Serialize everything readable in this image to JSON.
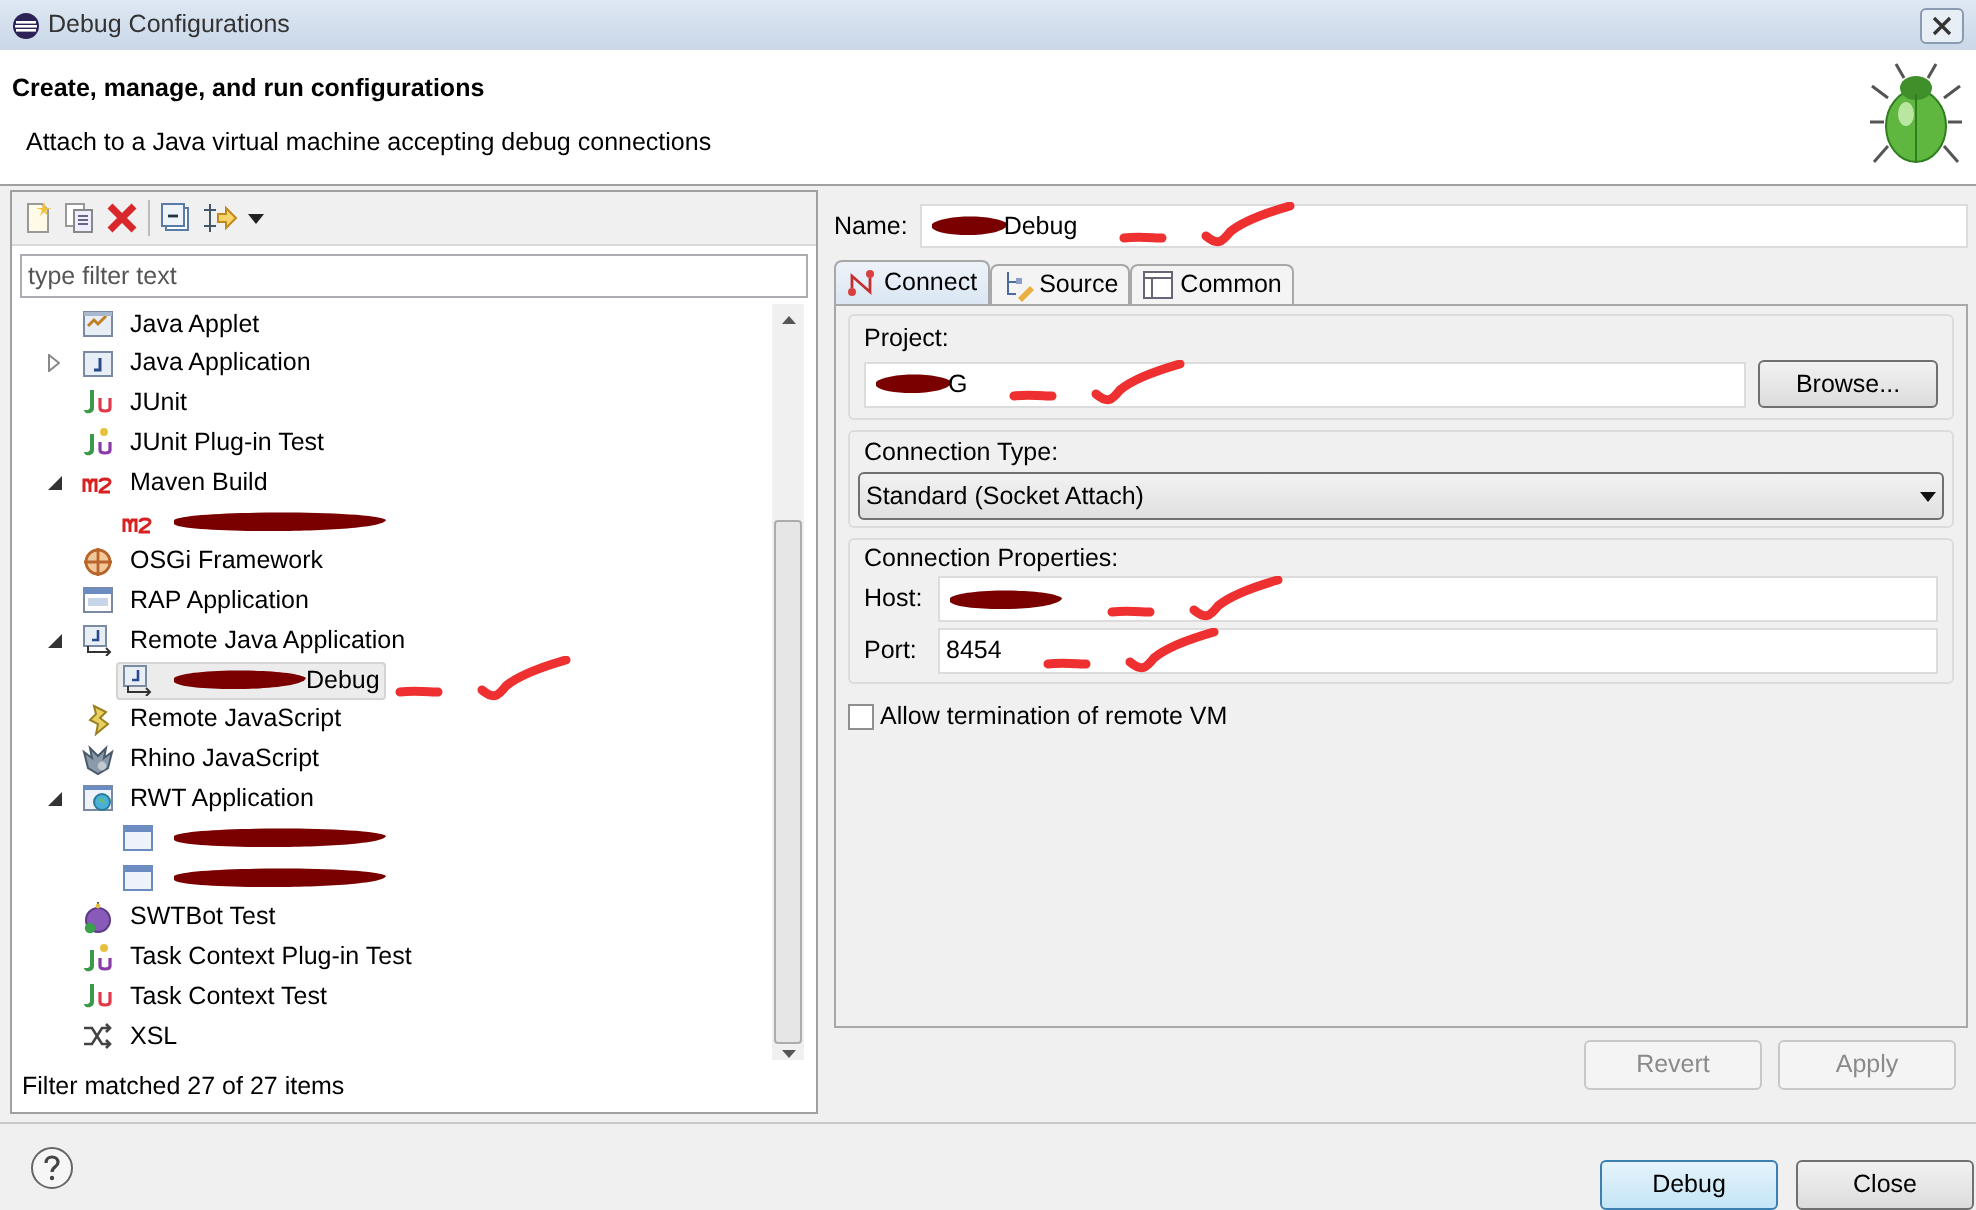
{
  "window": {
    "title": "Debug Configurations"
  },
  "header": {
    "title": "Create, manage, and run configurations",
    "message": "Attach to a Java virtual machine accepting debug connections"
  },
  "filter": {
    "placeholder": "type filter text"
  },
  "tree": [
    {
      "label": "Java Applet",
      "kind": "applet",
      "selected": false
    },
    {
      "label": "Java Application",
      "kind": "java",
      "expanded": false,
      "selected": false
    },
    {
      "label": "JUnit",
      "kind": "junit",
      "selected": false
    },
    {
      "label": "JUnit Plug-in Test",
      "kind": "junitplugin",
      "selected": false
    },
    {
      "label": "Maven Build",
      "kind": "maven",
      "expanded": true,
      "selected": false,
      "children": [
        {
          "kind": "maven",
          "redacted": true,
          "selected": false
        }
      ]
    },
    {
      "label": "OSGi Framework",
      "kind": "osgi",
      "selected": false
    },
    {
      "label": "RAP Application",
      "kind": "rap",
      "selected": false
    },
    {
      "label": "Remote Java Application",
      "kind": "remote",
      "expanded": true,
      "selected": false,
      "children": [
        {
          "label": "Debug",
          "kind": "remote",
          "redacted": true,
          "selected": true,
          "annotated": true
        }
      ]
    },
    {
      "label": "Remote JavaScript",
      "kind": "remotejs",
      "selected": false
    },
    {
      "label": "Rhino JavaScript",
      "kind": "rhino",
      "selected": false
    },
    {
      "label": "RWT Application",
      "kind": "rwt",
      "expanded": true,
      "selected": false,
      "children": [
        {
          "kind": "window",
          "redacted": true,
          "selected": false
        },
        {
          "kind": "window",
          "redacted": true,
          "selected": false
        }
      ]
    },
    {
      "label": "SWTBot Test",
      "kind": "swtbot",
      "selected": false
    },
    {
      "label": "Task Context Plug-in Test",
      "kind": "junitplugin",
      "selected": false
    },
    {
      "label": "Task Context Test",
      "kind": "junit",
      "selected": false
    },
    {
      "label": "XSL",
      "kind": "xsl",
      "selected": false
    }
  ],
  "filter_status": "Filter matched 27 of 27 items",
  "name": {
    "label": "Name:",
    "value": "Debug",
    "redacted": true,
    "annotated": true
  },
  "tabs": [
    {
      "label": "Connect",
      "kind": "connect",
      "selected": true
    },
    {
      "label": "Source",
      "kind": "source",
      "selected": false
    },
    {
      "label": "Common",
      "kind": "common",
      "selected": false
    }
  ],
  "project": {
    "title": "Project:",
    "value": "G",
    "redacted": true,
    "annotated": true,
    "button": "Browse..."
  },
  "connection_type": {
    "title": "Connection Type:",
    "value": "Standard (Socket Attach)"
  },
  "connection_properties": {
    "title": "Connection Properties:",
    "fields": [
      {
        "label": "Host:",
        "redacted": true,
        "annotated": true
      },
      {
        "label": "Port:",
        "value": "8454",
        "annotated": true
      }
    ]
  },
  "allow_termination": {
    "label": "Allow termination of remote VM",
    "checked": false
  },
  "actions": [
    {
      "label": "Revert",
      "disabled": true
    },
    {
      "label": "Apply",
      "disabled": true
    }
  ],
  "buttons": [
    {
      "label": "Debug",
      "default": true
    },
    {
      "label": "Close",
      "default": false
    }
  ]
}
